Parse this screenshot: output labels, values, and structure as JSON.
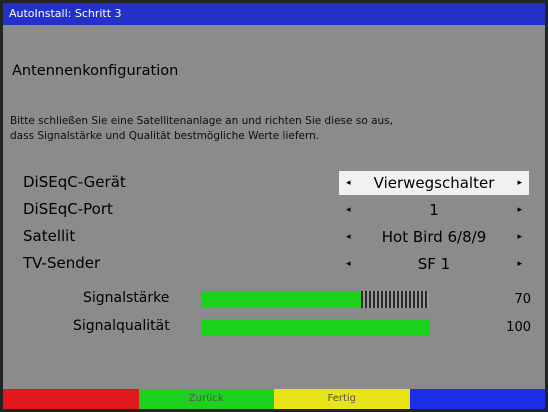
{
  "window": {
    "title": "AutoInstall: Schritt 3"
  },
  "heading": "Antennenkonfiguration",
  "description": {
    "line1": "Bitte schließen Sie eine Satellitenanlage an und richten Sie diese so aus,",
    "line2": "dass Signalstärke und Qualität bestmögliche Werte liefern."
  },
  "settings": [
    {
      "label": "DiSEqC-Gerät",
      "value": "Vierwegschalter"
    },
    {
      "label": "DiSEqC-Port",
      "value": "1"
    },
    {
      "label": "Satellit",
      "value": "Hot Bird 6/8/9"
    },
    {
      "label": "TV-Sender",
      "value": "SF 1"
    }
  ],
  "signal": {
    "strength": {
      "label": "Signalstärke",
      "value": "70",
      "level": 0.7
    },
    "quality": {
      "label": "Signalqualität",
      "value": "100",
      "level": 1.0
    }
  },
  "footer": {
    "red": "",
    "green": "Zurück",
    "yellow": "Fertig",
    "blue": ""
  },
  "colors": {
    "title_bar": "#2431c8",
    "red": "#e01a1a",
    "green": "#1ed11e",
    "yellow": "#e9e417",
    "blue": "#1c2ee6",
    "bar_fill": "#1ad21a"
  },
  "icons": {
    "left": "◂",
    "right": "▸"
  }
}
